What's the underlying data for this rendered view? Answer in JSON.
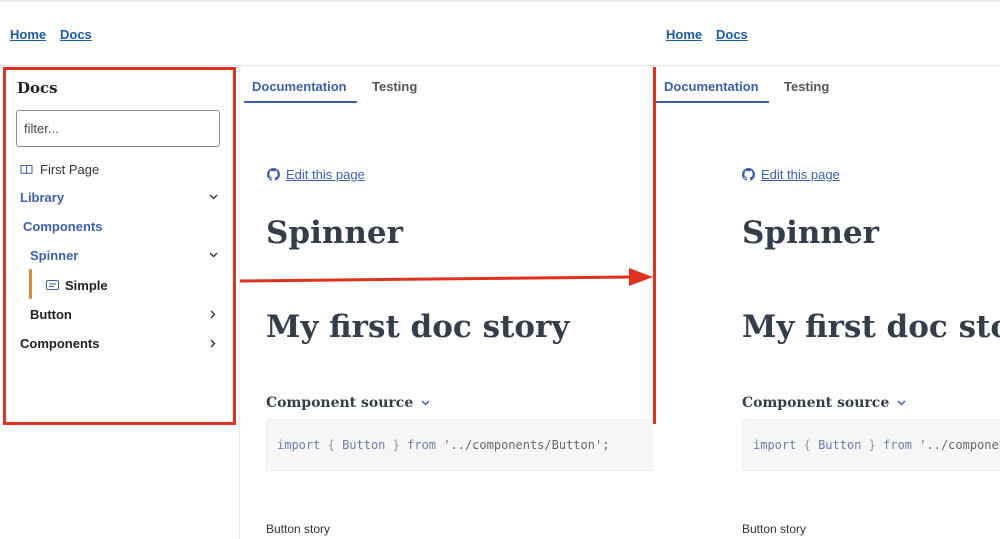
{
  "header": {
    "left_links": [
      "Home",
      "Docs"
    ],
    "right_links": [
      "Home",
      "Docs"
    ]
  },
  "sidebar": {
    "title": "Docs",
    "filter_placeholder": "filter...",
    "items": [
      {
        "label": "First Page",
        "icon": "book-icon"
      },
      {
        "label": "Library",
        "chevron": "down"
      },
      {
        "label": "Components",
        "chevron": "none"
      },
      {
        "label": "Spinner",
        "chevron": "down"
      },
      {
        "label": "Simple",
        "icon": "story-icon",
        "active": true
      },
      {
        "label": "Button",
        "chevron": "right"
      },
      {
        "label": "Components",
        "chevron": "right"
      }
    ]
  },
  "panel_left": {
    "tabs": [
      "Documentation",
      "Testing"
    ],
    "active_tab": "Documentation",
    "edit_link": "Edit this page",
    "title": "Spinner",
    "story_title": "My first doc story",
    "component_source_label": "Component source",
    "code": {
      "kw1": "import",
      "open": "{",
      "name": "Button",
      "close": "}",
      "kw2": "from",
      "path": "'../components/Button';"
    },
    "story_label": "Button story"
  },
  "panel_right": {
    "tabs": [
      "Documentation",
      "Testing"
    ],
    "active_tab": "Documentation",
    "edit_link": "Edit this page",
    "title": "Spinner",
    "story_title": "My first doc story",
    "component_source_label": "Component source",
    "code": {
      "kw1": "import",
      "open": "{",
      "name": "Button",
      "close": "}",
      "kw2": "from",
      "path": "'../components/Button';"
    },
    "story_label": "Button story"
  },
  "colors": {
    "accent": "#3d5fae",
    "link": "#1c5aa8",
    "annotation_red": "#e0301e",
    "active_marker": "#d88b3a"
  }
}
